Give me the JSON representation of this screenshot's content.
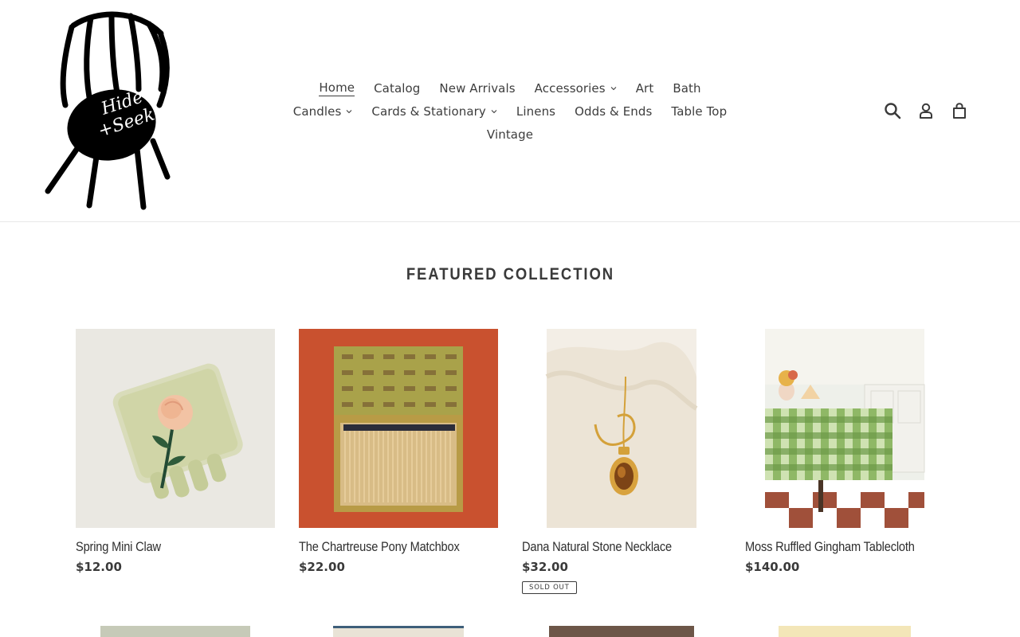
{
  "logo": {
    "text_line1": "Hide",
    "text_line2": "+Seek"
  },
  "nav": {
    "row1": [
      {
        "label": "Home",
        "active": true,
        "dropdown": false
      },
      {
        "label": "Catalog",
        "active": false,
        "dropdown": false
      },
      {
        "label": "New Arrivals",
        "active": false,
        "dropdown": false
      },
      {
        "label": "Accessories",
        "active": false,
        "dropdown": true
      },
      {
        "label": "Art",
        "active": false,
        "dropdown": false
      },
      {
        "label": "Bath",
        "active": false,
        "dropdown": false
      }
    ],
    "row2": [
      {
        "label": "Candles",
        "active": false,
        "dropdown": true
      },
      {
        "label": "Cards & Stationary",
        "active": false,
        "dropdown": true
      },
      {
        "label": "Linens",
        "active": false,
        "dropdown": false
      },
      {
        "label": "Odds & Ends",
        "active": false,
        "dropdown": false
      },
      {
        "label": "Table Top",
        "active": false,
        "dropdown": false
      }
    ],
    "row3": [
      {
        "label": "Vintage",
        "active": false,
        "dropdown": false
      }
    ]
  },
  "header_icons": [
    "search-icon",
    "account-icon",
    "cart-icon"
  ],
  "featured": {
    "title": "Featured collection",
    "products": [
      {
        "title": "Spring Mini Claw",
        "price": "$12.00",
        "badge": ""
      },
      {
        "title": "The Chartreuse Pony Matchbox",
        "price": "$22.00",
        "badge": ""
      },
      {
        "title": "Dana Natural Stone Necklace",
        "price": "$32.00",
        "badge": "Sold out"
      },
      {
        "title": "Moss Ruffled Gingham Tablecloth",
        "price": "$140.00",
        "badge": ""
      }
    ]
  },
  "colors": {
    "text": "#3a3a3a",
    "border": "#e8e8e8",
    "matchbox_bg": "#c8502f",
    "gingham": "#7aa552"
  }
}
